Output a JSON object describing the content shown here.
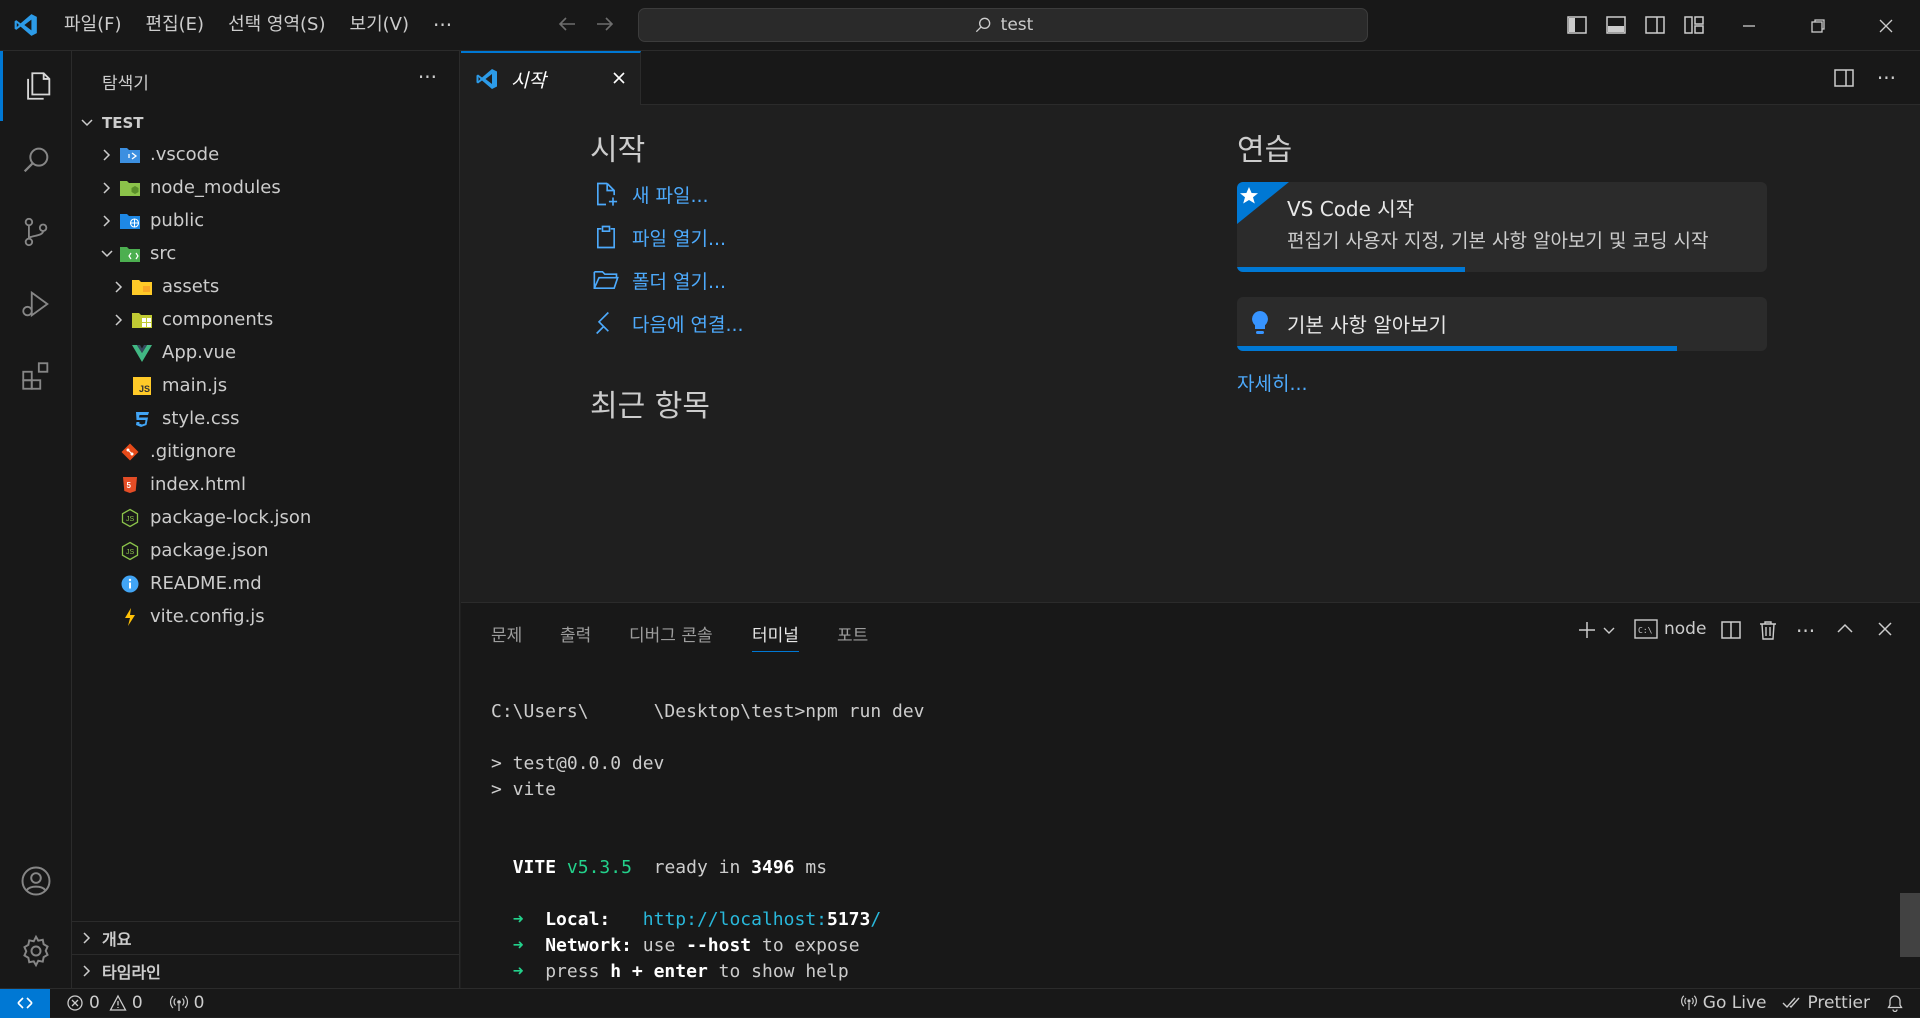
{
  "menu": {
    "items": [
      "파일(F)",
      "편집(E)",
      "선택 영역(S)",
      "보기(V)"
    ],
    "more": "···"
  },
  "command_center": {
    "text": "test"
  },
  "colors": {
    "accent": "#0078d4",
    "link": "#4daafc",
    "terminal_green": "#23d18b",
    "terminal_cyan": "#29b8db"
  },
  "sidebar": {
    "title": "탐색기",
    "more": "···",
    "folder": "TEST",
    "tree": [
      {
        "label": ".vscode",
        "icon": "vscode-folder-icon",
        "depth": 1,
        "chevron": "right"
      },
      {
        "label": "node_modules",
        "icon": "node-folder-icon",
        "depth": 1,
        "chevron": "right"
      },
      {
        "label": "public",
        "icon": "public-folder-icon",
        "depth": 1,
        "chevron": "right"
      },
      {
        "label": "src",
        "icon": "src-folder-icon",
        "depth": 1,
        "chevron": "down"
      },
      {
        "label": "assets",
        "icon": "assets-folder-icon",
        "depth": 2,
        "chevron": "right"
      },
      {
        "label": "components",
        "icon": "components-folder-icon",
        "depth": 2,
        "chevron": "right"
      },
      {
        "label": "App.vue",
        "icon": "vue-file-icon",
        "depth": 2,
        "chevron": ""
      },
      {
        "label": "main.js",
        "icon": "js-file-icon",
        "depth": 2,
        "chevron": ""
      },
      {
        "label": "style.css",
        "icon": "css-file-icon",
        "depth": 2,
        "chevron": ""
      },
      {
        "label": ".gitignore",
        "icon": "git-file-icon",
        "depth": 1,
        "chevron": ""
      },
      {
        "label": "index.html",
        "icon": "html-file-icon",
        "depth": 1,
        "chevron": ""
      },
      {
        "label": "package-lock.json",
        "icon": "node-file-icon",
        "depth": 1,
        "chevron": ""
      },
      {
        "label": "package.json",
        "icon": "node-file-icon",
        "depth": 1,
        "chevron": ""
      },
      {
        "label": "README.md",
        "icon": "info-file-icon",
        "depth": 1,
        "chevron": ""
      },
      {
        "label": "vite.config.js",
        "icon": "vite-file-icon",
        "depth": 1,
        "chevron": ""
      }
    ],
    "sections": [
      "개요",
      "타임라인"
    ]
  },
  "editor": {
    "tab_label": "시작",
    "start_heading": "시작",
    "start_links": [
      "새 파일...",
      "파일 열기...",
      "폴더 열기...",
      "다음에 연결..."
    ],
    "recent_heading": "최근 항목",
    "walkthrough_heading": "연습",
    "walkthrough_cards": [
      {
        "title": "VS Code 시작",
        "description": "편집기 사용자 지정, 기본 사항 알아보기 및 코딩 시작",
        "progress": 0.43
      },
      {
        "title": "기본 사항 알아보기",
        "progress": 0.83
      }
    ],
    "more_link": "자세히..."
  },
  "panel": {
    "tabs": [
      "문제",
      "출력",
      "디버그 콘솔",
      "터미널",
      "포트"
    ],
    "active_tab": "터미널",
    "terminal_name": "node",
    "terminal": {
      "prompt_path_1": "C:\\Users\\",
      "prompt_path_2": "\\Desktop\\test>",
      "command": "npm run dev",
      "line_script": "> test@0.0.0 dev",
      "line_vite": "> vite",
      "vite_name": "VITE",
      "vite_version": "v5.3.5",
      "ready_text": "ready in",
      "ready_ms": "3496",
      "ms_unit": "ms",
      "arrow": "➜",
      "local_label": "Local:",
      "local_url_prefix": "http://localhost:",
      "local_port": "5173",
      "local_url_suffix": "/",
      "network_label": "Network:",
      "network_use": "use",
      "network_flag": "--host",
      "network_rest": "to expose",
      "help_press": "press",
      "help_keys": "h + enter",
      "help_rest": "to show help"
    }
  },
  "statusbar": {
    "errors": "0",
    "warnings": "0",
    "ports": "0",
    "go_live": "Go Live",
    "prettier": "Prettier"
  }
}
